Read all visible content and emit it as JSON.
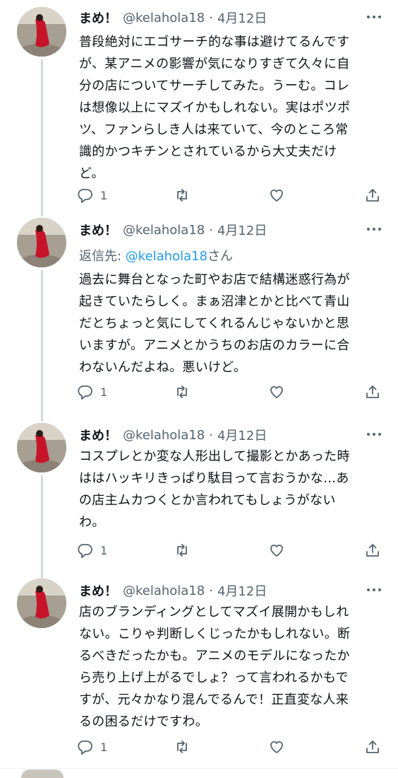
{
  "tweets": [
    {
      "name": "まめ！",
      "handle": "@kelahola18",
      "separator": "·",
      "date": "4月12日",
      "reply_prefix": "",
      "reply_handle": "",
      "reply_suffix": "",
      "lines": [
        "普段絶対にエゴサーチ的な事は避けてるんです",
        "が、某アニメの影響が気になりすぎて久々に自",
        "分の店についてサーチしてみた。うーむ。コレ",
        "は想像以上にマズイかもしれない。実はポツポ",
        "ツ、ファンらしき人は来ていて、今のところ常",
        "識的かつキチンとされているから大丈夫だけ",
        "ど。"
      ],
      "reply_count": "1"
    },
    {
      "name": "まめ！",
      "handle": "@kelahola18",
      "separator": "·",
      "date": "4月12日",
      "reply_prefix": "返信先: ",
      "reply_handle": "@kelahola18",
      "reply_suffix": "さん",
      "lines": [
        "過去に舞台となった町やお店で結構迷惑行為が",
        "起きていたらしく。まぁ沼津とかと比べて青山",
        "だとちょっと気にしてくれるんじゃないかと思",
        "いますが。アニメとかうちのお店のカラーに合",
        "わないんだよね。悪いけど。"
      ],
      "reply_count": "1"
    },
    {
      "name": "まめ！",
      "handle": "@kelahola18",
      "separator": "·",
      "date": "4月12日",
      "reply_prefix": "",
      "reply_handle": "",
      "reply_suffix": "",
      "lines": [
        "コスプレとか変な人形出して撮影とかあった時",
        "ははハッキリきっぱり駄目って言おうかな…あ",
        "の店主ムカつくとか言われてもしょうがない",
        "わ。"
      ],
      "reply_count": "1"
    },
    {
      "name": "まめ！",
      "handle": "@kelahola18",
      "separator": "·",
      "date": "4月12日",
      "reply_prefix": "",
      "reply_handle": "",
      "reply_suffix": "",
      "lines": [
        "店のブランディングとしてマズイ展開かもしれ",
        "ない。こりゃ判断しくじったかもしれない。断",
        "るべきだったかも。アニメのモデルになったか",
        "ら売り上げ上がるでしょ？って言われるかもで",
        "すが、元々かなり混んでるんで！正直変な人来",
        "るの困るだけですわ。"
      ],
      "reply_count": "1"
    }
  ],
  "icons": {
    "more": "more-icon",
    "reply": "reply-icon",
    "retweet": "retweet-icon",
    "like": "like-icon",
    "share": "share-icon"
  },
  "colors": {
    "text": "#0f1419",
    "secondary": "#536471",
    "link": "#1d9bf0",
    "thread_line": "#cfd9de"
  }
}
